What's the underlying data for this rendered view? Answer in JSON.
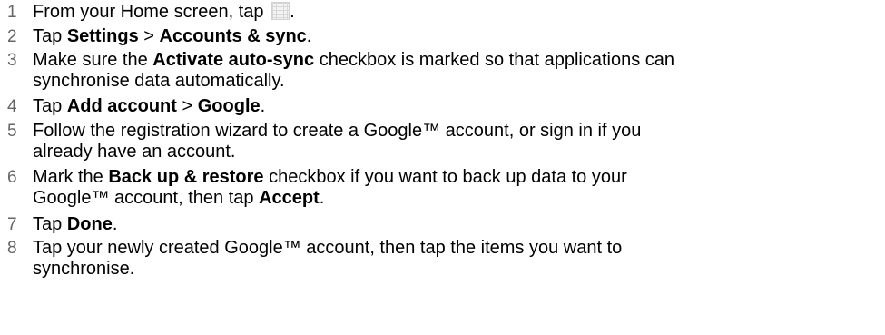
{
  "steps": [
    {
      "number": "1",
      "before_icon": "From your Home screen, tap ",
      "icon": "apps-grid-icon",
      "after_icon": "."
    },
    {
      "number": "2",
      "pre": "Tap ",
      "bold1": "Settings",
      "mid": " > ",
      "bold2": "Accounts & sync",
      "post": "."
    },
    {
      "number": "3",
      "pre": "Make sure the ",
      "bold1": "Activate auto-sync",
      "post": " checkbox is marked so that applications can",
      "line2": "synchronise data automatically."
    },
    {
      "number": "4",
      "pre": "Tap ",
      "bold1": "Add account",
      "mid": " > ",
      "bold2": "Google",
      "post": "."
    },
    {
      "number": "5",
      "text": "Follow the registration wizard to create a Google™ account, or sign in if you",
      "line2": "already have an account."
    },
    {
      "number": "6",
      "pre": "Mark the ",
      "bold1": "Back up & restore",
      "post": " checkbox if you want to back up data to your",
      "line2_pre": "Google™ account, then tap ",
      "line2_bold": "Accept",
      "line2_post": "."
    },
    {
      "number": "7",
      "pre": "Tap ",
      "bold1": "Done",
      "post": "."
    },
    {
      "number": "8",
      "text": "Tap your newly created Google™ account, then tap the items you want to",
      "line2": "synchronise."
    }
  ]
}
